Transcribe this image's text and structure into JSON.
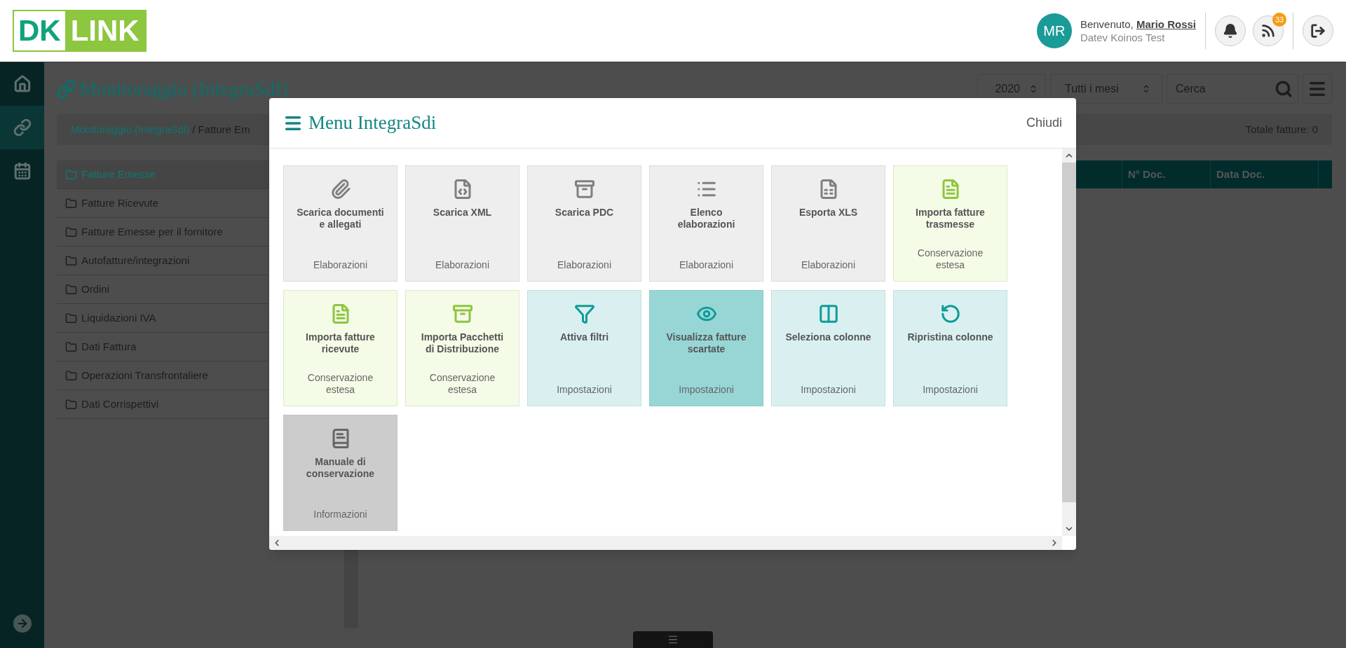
{
  "header": {
    "logo": [
      "DK",
      "LINK"
    ],
    "user": {
      "initials": "MR",
      "greeting": "Benvenuto,",
      "name": "Mario Rossi",
      "company": "Datev Koinos Test"
    },
    "notifications": {
      "count": "33"
    }
  },
  "nav": [
    {
      "selected": false
    },
    {
      "selected": true
    },
    {
      "selected": false
    }
  ],
  "page": {
    "title": "Monitoraggio (IntegraSdI)",
    "filters": {
      "year": "2020",
      "month": "Tutti i mesi",
      "search_placeholder": "Cerca"
    },
    "breadcrumb": [
      {
        "label": "Monitoraggio (IntegraSdl)",
        "kind": "link"
      },
      {
        "label": "/",
        "kind": "separator"
      },
      {
        "label": "Fatture Em",
        "kind": "current"
      }
    ],
    "total": "Totale fatture: 0",
    "tree": [
      {
        "label": "Fatture Emesse",
        "selected": true
      },
      {
        "label": "Fatture Ricevute",
        "selected": false
      },
      {
        "label": "Fatture Emesse per il fornitore",
        "selected": false
      },
      {
        "label": "Autofatture/integrazioni",
        "selected": false
      },
      {
        "label": "Ordini",
        "selected": false
      },
      {
        "label": "Liquidazioni IVA",
        "selected": false
      },
      {
        "label": "Dati Fattura",
        "selected": false
      },
      {
        "label": "Operazioni Transfrontaliere",
        "selected": false
      },
      {
        "label": "Dati Corrispettivi",
        "selected": false
      }
    ],
    "table": {
      "columns": [
        "N° Doc.",
        "Data Doc."
      ]
    }
  },
  "modal": {
    "title": "Menu IntegraSdi",
    "close": "Chiudi",
    "tiles": [
      {
        "label": "Scarica documenti e allegati",
        "category": "Elaborazioni",
        "kind": "grey",
        "selected": false
      },
      {
        "label": "Scarica XML",
        "category": "Elaborazioni",
        "kind": "grey",
        "selected": false
      },
      {
        "label": "Scarica PDC",
        "category": "Elaborazioni",
        "kind": "grey",
        "selected": false
      },
      {
        "label": "Elenco elaborazioni",
        "category": "Elaborazioni",
        "kind": "grey",
        "selected": false
      },
      {
        "label": "Esporta XLS",
        "category": "Elaborazioni",
        "kind": "grey",
        "selected": false
      },
      {
        "label": "Importa fatture trasmesse",
        "category": "Conservazione estesa",
        "kind": "green",
        "selected": false
      },
      {
        "label": "Importa fatture ricevute",
        "category": "Conservazione estesa",
        "kind": "green",
        "selected": false
      },
      {
        "label": "Importa Pacchetti di Distribuzione",
        "category": "Conservazione estesa",
        "kind": "green",
        "selected": false
      },
      {
        "label": "Attiva filtri",
        "category": "Impostazioni",
        "kind": "teal",
        "selected": false
      },
      {
        "label": "Visualizza fatture scartate",
        "category": "Impostazioni",
        "kind": "teal",
        "selected": true
      },
      {
        "label": "Seleziona colonne",
        "category": "Impostazioni",
        "kind": "teal",
        "selected": false
      },
      {
        "label": "Ripristina colonne",
        "category": "Impostazioni",
        "kind": "teal",
        "selected": false
      },
      {
        "label": "Manuale di conservazione",
        "category": "Informazioni",
        "kind": "info",
        "selected": false
      }
    ]
  }
}
